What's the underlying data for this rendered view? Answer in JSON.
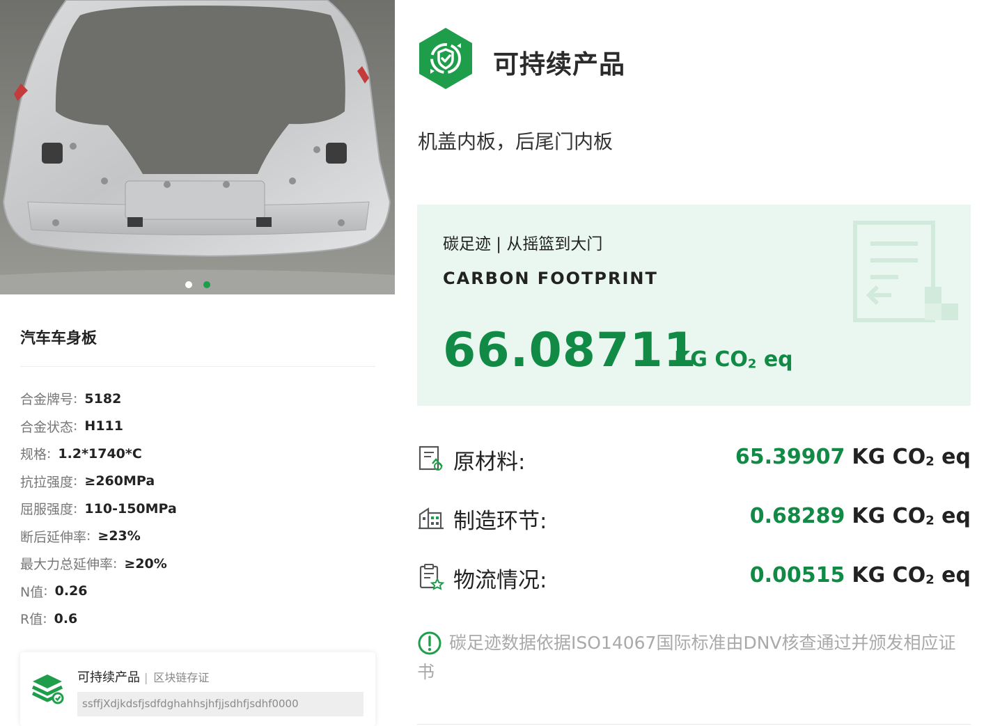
{
  "colors": {
    "accent_green": "#118a45",
    "card_bg": "#eaf7f0",
    "dot_active": "#1e9e4a"
  },
  "gallery": {
    "image_icon": "car-tailgate-inner-panel-photo",
    "active_index": 1,
    "total": 2
  },
  "product": {
    "name": "汽车车身板",
    "specs": [
      {
        "label": "合金牌号",
        "value": "5182"
      },
      {
        "label": "合金状态",
        "value": "H111"
      },
      {
        "label": "规格",
        "value": "1.2*1740*C"
      },
      {
        "label": "抗拉强度",
        "value": "≥260MPa"
      },
      {
        "label": "屈服强度",
        "value": "110-150MPa"
      },
      {
        "label": "断后延伸率",
        "value": "≥23%"
      },
      {
        "label": "最大力总延伸率",
        "value": "≥20%"
      },
      {
        "label": "N值",
        "value": "0.26"
      },
      {
        "label": "R值",
        "value": "0.6"
      }
    ],
    "spec_separator": ":"
  },
  "blockchain_card": {
    "icon": "layers-stack-icon",
    "title": "可持续产品",
    "separator": "|",
    "subtitle": "区块链存证",
    "hash": "ssffjXdjkdsfjsdfdghahhsjhfjjsdhfjsdhf0000"
  },
  "header": {
    "logo_icon": "sustainable-hexagon-logo",
    "title": "可持续产品",
    "parts": "机盖内板，后尾门内板"
  },
  "carbon_card": {
    "heading": "碳足迹 | 从摇篮到大门",
    "heading_en": "CARBON FOOTPRINT",
    "total_value": "66.08711",
    "unit_prefix": "KG CO",
    "unit_sub": "2",
    "unit_suffix": " eq",
    "watermark_icon": "document-arrow-watermark-icon"
  },
  "breakdown": [
    {
      "icon": "raw-material-document-icon",
      "label": "原材料:",
      "value": "65.39907",
      "unit_prefix": "KG CO",
      "unit_sub": "2",
      "unit_suffix": " eq"
    },
    {
      "icon": "factory-building-icon",
      "label": "制造环节:",
      "value": "0.68289",
      "unit_prefix": "KG CO",
      "unit_sub": "2",
      "unit_suffix": " eq"
    },
    {
      "icon": "logistics-clipboard-icon",
      "label": "物流情况:",
      "value": "0.00515",
      "unit_prefix": "KG CO",
      "unit_sub": "2",
      "unit_suffix": " eq"
    }
  ],
  "note": {
    "icon": "exclamation-circle-icon",
    "text": "碳足迹数据依据ISO14067国际标准由DNV核查通过并颁发相应证书"
  }
}
